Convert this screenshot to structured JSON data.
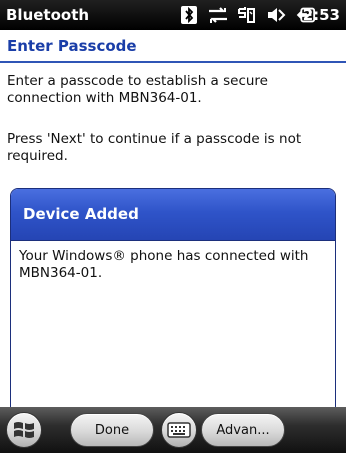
{
  "titlebar": {
    "app_title": "Bluetooth",
    "time": "2:53",
    "icons": [
      "bluetooth-icon",
      "connectivity-icon",
      "phone-signal-icon",
      "volume-icon",
      "battery-icon"
    ]
  },
  "header": {
    "title": "Enter Passcode"
  },
  "body": {
    "line1": "Enter a passcode to establish a secure connection with MBN364-01.",
    "line2": "Press 'Next' to continue if a passcode is not required."
  },
  "dialog": {
    "title": "Device Added",
    "message": "Your Windows® phone has connected with MBN364-01."
  },
  "bottombar": {
    "start_icon": "windows-start-icon",
    "done_label": "Done",
    "keyboard_icon": "keyboard-icon",
    "advanced_label": "Advan..."
  },
  "colors": {
    "header_text": "#1a3ea8",
    "dialog_header": "#2f54c9",
    "titlebar_bg": "#000000"
  }
}
